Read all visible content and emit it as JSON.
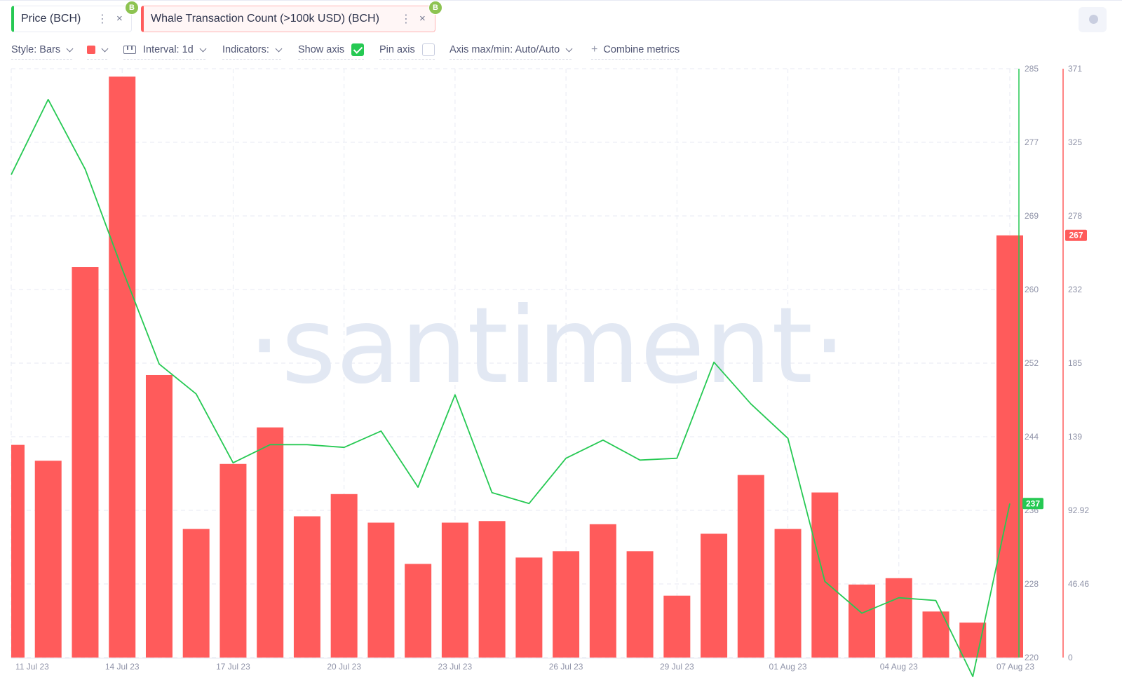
{
  "metrics": [
    {
      "label": "Price (BCH)",
      "color": "#26c953",
      "badge_icon": "bitcoin-cash-icon",
      "badge_glyph": "B",
      "menu_glyph": "⋮",
      "close_glyph": "×"
    },
    {
      "label": "Whale Transaction Count (>100k USD) (BCH)",
      "color": "#ff5b5b",
      "badge_icon": "bitcoin-cash-icon",
      "badge_glyph": "B",
      "menu_glyph": "⋮",
      "close_glyph": "×"
    }
  ],
  "toolbar": {
    "style_label": "Style: Bars",
    "color_swatch": "#ff5b5b",
    "interval_label": "Interval: 1d",
    "indicators_label": "Indicators:",
    "show_axis_label": "Show axis",
    "show_axis_checked": true,
    "pin_axis_label": "Pin axis",
    "pin_axis_checked": false,
    "axis_label": "Axis max/min: Auto/Auto",
    "combine_label": "Combine metrics",
    "combine_glyph": "+"
  },
  "watermark": "·santiment·",
  "chart_data": {
    "type": "bar+line",
    "x": [
      "11 Jul 23",
      "12 Jul 23",
      "13 Jul 23",
      "14 Jul 23",
      "15 Jul 23",
      "16 Jul 23",
      "17 Jul 23",
      "18 Jul 23",
      "19 Jul 23",
      "20 Jul 23",
      "21 Jul 23",
      "22 Jul 23",
      "23 Jul 23",
      "24 Jul 23",
      "25 Jul 23",
      "26 Jul 23",
      "27 Jul 23",
      "28 Jul 23",
      "29 Jul 23",
      "30 Jul 23",
      "31 Jul 23",
      "01 Aug 23",
      "02 Aug 23",
      "03 Aug 23",
      "04 Aug 23",
      "05 Aug 23",
      "06 Aug 23",
      "07 Aug 23"
    ],
    "x_tick_labels": [
      "11 Jul 23",
      "14 Jul 23",
      "17 Jul 23",
      "20 Jul 23",
      "23 Jul 23",
      "26 Jul 23",
      "29 Jul 23",
      "01 Aug 23",
      "04 Aug 23",
      "07 Aug 23"
    ],
    "series": [
      {
        "name": "Price (BCH)",
        "type": "line",
        "color": "#26c953",
        "axis": "left",
        "values": [
          273.3,
          281.6,
          273.9,
          262.9,
          252.4,
          249.1,
          241.5,
          243.5,
          243.5,
          243.2,
          245.0,
          238.8,
          249.0,
          238.2,
          237.0,
          242.0,
          244.0,
          241.8,
          242.0,
          252.6,
          248.0,
          244.2,
          228.4,
          224.9,
          226.6,
          226.3,
          217.9,
          237.0
        ]
      },
      {
        "name": "Whale Transaction Count (>100k USD) (BCH)",
        "type": "bar",
        "color": "#ff5b5b",
        "axis": "right",
        "values": [
          134,
          124,
          246,
          366,
          178,
          81,
          122,
          145,
          89,
          103,
          85,
          59,
          85,
          86,
          63,
          67,
          84,
          67,
          39,
          78,
          115,
          81,
          104,
          46,
          50,
          29,
          22,
          266
        ]
      }
    ],
    "y_left": {
      "range": [
        220,
        285
      ],
      "ticks": [
        "285",
        "277",
        "269",
        "260",
        "252",
        "244",
        "236",
        "228",
        "220"
      ],
      "last_value_badge": "237"
    },
    "y_right": {
      "range": [
        0,
        371
      ],
      "ticks": [
        "371",
        "325",
        "278",
        "232",
        "185",
        "139",
        "92.92",
        "46.46",
        "0"
      ],
      "last_value_badge": "267"
    },
    "grid": true,
    "legend": "top-left"
  }
}
